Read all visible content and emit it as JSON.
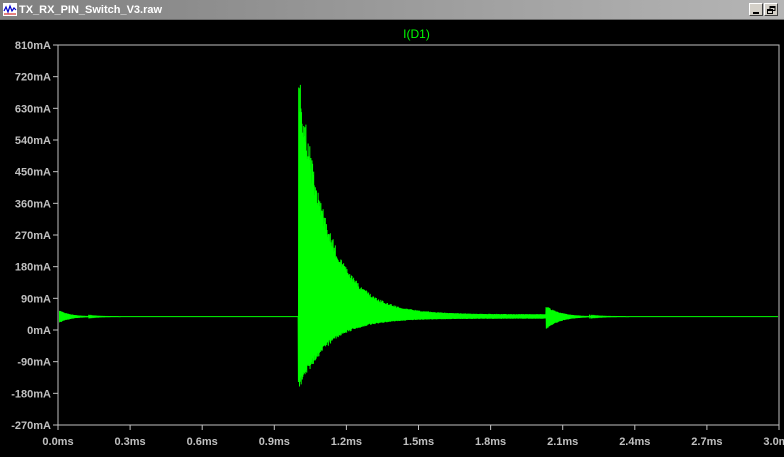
{
  "window": {
    "title": "TX_RX_PIN_Switch_V3.raw"
  },
  "colors": {
    "trace": "#00ff00",
    "axis": "#c0c0c0",
    "background": "#000000"
  },
  "icons": {
    "app": "waveform-icon",
    "minimize": "minimize-icon",
    "restore": "restore-icon"
  },
  "chart_data": {
    "type": "line",
    "title": "",
    "xlabel": "",
    "ylabel": "",
    "x_unit": "ms",
    "y_unit": "mA",
    "xlim": [
      0,
      3.0
    ],
    "ylim": [
      -270,
      810
    ],
    "x_ticks": [
      "0.0ms",
      "0.3ms",
      "0.6ms",
      "0.9ms",
      "1.2ms",
      "1.5ms",
      "1.8ms",
      "2.1ms",
      "2.4ms",
      "2.7ms",
      "3.0ms"
    ],
    "y_ticks": [
      "810mA",
      "720mA",
      "630mA",
      "540mA",
      "450mA",
      "360mA",
      "270mA",
      "180mA",
      "90mA",
      "0mA",
      "-90mA",
      "-180mA",
      "-270mA"
    ],
    "grid": false,
    "legend": "top-center",
    "series": [
      {
        "name": "I(D1)",
        "baseline_mA": 38,
        "events": [
          {
            "x_ms": 0.0,
            "peak_mA": 58,
            "trough_mA": 18,
            "decay_ms": 0.05
          },
          {
            "x_ms": 1.0,
            "peak_mA": 750,
            "trough_mA": -180,
            "decay_ms": 0.12
          },
          {
            "x_ms": 2.03,
            "peak_mA": 70,
            "trough_mA": 0,
            "decay_ms": 0.06
          }
        ]
      }
    ]
  }
}
